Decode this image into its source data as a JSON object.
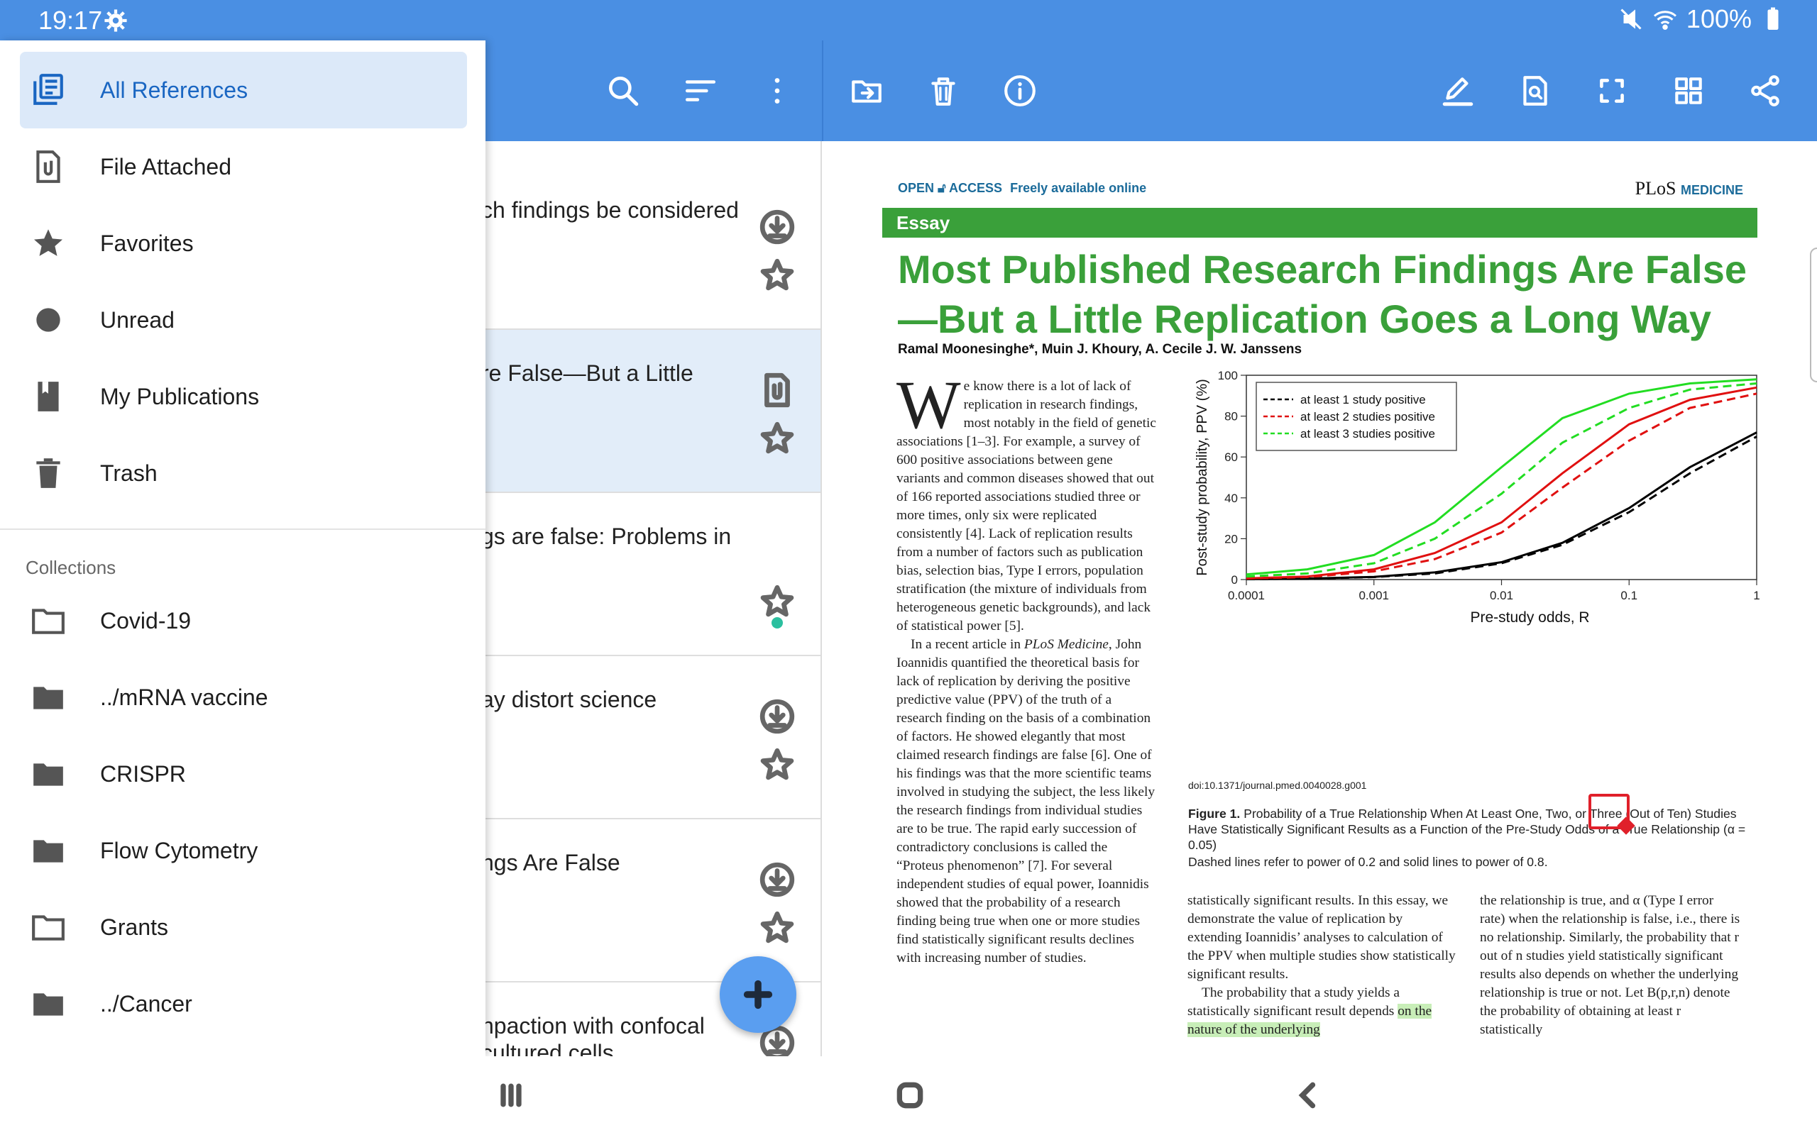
{
  "status": {
    "time": "19:17",
    "battery": "100%"
  },
  "list": {
    "rows": [
      {
        "title": "ch findings be considered",
        "has_pdf": false,
        "unread": false,
        "selected": false
      },
      {
        "title": "re False—But a Little",
        "has_pdf": true,
        "unread": false,
        "selected": true
      },
      {
        "title": "gs are false: Problems in",
        "has_pdf": null,
        "unread": true,
        "selected": false
      },
      {
        "title": "ay distort science",
        "has_pdf": false,
        "unread": false,
        "selected": false
      },
      {
        "title": "ngs Are False",
        "has_pdf": false,
        "unread": false,
        "selected": false
      },
      {
        "title": "npaction with confocal",
        "title2": "cultured cells",
        "has_pdf": false,
        "unread": false,
        "selected": false
      }
    ]
  },
  "drawer": {
    "items": [
      {
        "label": "All References",
        "icon": "library-icon",
        "selected": true
      },
      {
        "label": "File Attached",
        "icon": "attachment-file-icon"
      },
      {
        "label": "Favorites",
        "icon": "star-icon"
      },
      {
        "label": "Unread",
        "icon": "unread-dot-icon"
      },
      {
        "label": "My Publications",
        "icon": "bookmark-book-icon"
      },
      {
        "label": "Trash",
        "icon": "trash-icon"
      }
    ],
    "collections_header": "Collections",
    "collections": [
      {
        "label": "Covid-19",
        "icon": "folder-outline-icon"
      },
      {
        "label": "../mRNA vaccine",
        "icon": "folder-icon"
      },
      {
        "label": "CRISPR",
        "icon": "folder-icon"
      },
      {
        "label": "Flow Cytometry",
        "icon": "folder-icon"
      },
      {
        "label": "Grants",
        "icon": "folder-outline-icon"
      },
      {
        "label": "../Cancer",
        "icon": "folder-icon"
      }
    ]
  },
  "pdf": {
    "header_left_open": "OPEN",
    "header_left_access": "ACCESS",
    "header_left_free": "Freely available online",
    "journal_plos": "PLoS",
    "journal_medicine": "MEDICINE",
    "section": "Essay",
    "title": "Most Published Research Findings Are False—But a Little Replication Goes a Long Way",
    "authors": "Ramal Moonesinghe*, Muin J. Khoury, A. Cecile J. W. Janssens",
    "col1_dropcap": "W",
    "col1_p1": "e know there is a lot of lack of replication in research findings, most notably in the field of genetic associations [1–3]. For example, a survey of 600 positive associations between gene variants and common diseases showed that out of 166 reported associations studied three or more times, only six were replicated consistently [4]. Lack of replication results from a number of factors such as publication bias, selection bias, Type I errors, population stratification (the mixture of individuals from heterogeneous genetic backgrounds), and lack of statistical power [5].",
    "col1_p2a": "In a recent article in ",
    "col1_p2_em": "PLoS Medicine",
    "col1_p2b": ", John Ioannidis quantified the theoretical basis for lack of replication by deriving the positive predictive value (PPV) of the truth of a research finding on the basis of a combination of factors. He showed elegantly that most claimed research findings are false [6]. One of his findings was that the more scientific teams involved in studying the subject, the less likely the research findings from individual studies are to be true. The rapid early succession of contradictory conclusions is called the “Proteus phenomenon” [7]. For several independent studies of equal power, Ioannidis showed that the probability of a research finding being true when one or more studies find statistically significant results declines with increasing number of studies.",
    "col2_p1": "statistically significant results. In this essay, we demonstrate the value of replication by extending Ioannidis’ analyses to calculation of the PPV when multiple studies show statistically significant results.",
    "col2_p2": "The probability that a study yields a statistically significant result depends ",
    "col2_hl": "on the nature of the underlying",
    "col3_p1": "the relationship is true, and α (Type I error rate) when the relationship is false, i.e., there is no relationship. Similarly, the probability that r out of n studies yield statistically significant results also depends on whether the underlying relationship is true or not. Let B(p,r,n) denote the probability of obtaining at least r statistically",
    "doi": "doi:10.1371/journal.pmed.0040028.g001",
    "fig_label": "Figure 1.",
    "fig_caption": " Probability of a True Relationship When At Least One, Two, or Three (Out of Ten) Studies Have Statistically Significant Results as a Function of the Pre-Study Odds of a True Relationship (α = 0.05)",
    "fig_caption2": "Dashed lines refer to power of 0.2 and solid lines to power of 0.8."
  },
  "chart_data": {
    "type": "line",
    "xscale": "log",
    "xlim": [
      0.0001,
      1
    ],
    "ylim": [
      0,
      100
    ],
    "xlabel": "Pre-study odds, R",
    "ylabel": "Post-study probability, PPV (%)",
    "xticks": [
      "0.0001",
      "0.001",
      "0.01",
      "0.1",
      "1"
    ],
    "yticks": [
      "0",
      "20",
      "40",
      "60",
      "80",
      "100"
    ],
    "legend_position": "top-left",
    "legend": [
      {
        "label": "at least 1 study positive",
        "color": "#000000"
      },
      {
        "label": "at least 2 studies positive",
        "color": "#e01010"
      },
      {
        "label": "at least 3 studies positive",
        "color": "#22dd22"
      }
    ],
    "x": [
      0.0001,
      0.0003,
      0.001,
      0.003,
      0.01,
      0.03,
      0.1,
      0.3,
      1
    ],
    "series": [
      {
        "color": "#000000",
        "dash": false,
        "values": [
          0.2,
          0.5,
          1.3,
          3.5,
          8.5,
          18,
          35,
          55,
          72
        ]
      },
      {
        "color": "#000000",
        "dash": true,
        "values": [
          0.2,
          0.4,
          1.2,
          3.0,
          8.0,
          17,
          33,
          52,
          70
        ]
      },
      {
        "color": "#e01010",
        "dash": false,
        "values": [
          0.6,
          1.5,
          5,
          13,
          28,
          52,
          76,
          88,
          94
        ]
      },
      {
        "color": "#e01010",
        "dash": true,
        "values": [
          0.5,
          1.2,
          4,
          10,
          23,
          45,
          68,
          84,
          91
        ]
      },
      {
        "color": "#22dd22",
        "dash": false,
        "values": [
          2.5,
          5,
          12,
          28,
          55,
          79,
          91,
          96,
          98
        ]
      },
      {
        "color": "#22dd22",
        "dash": true,
        "values": [
          1.5,
          3,
          8,
          20,
          42,
          67,
          84,
          93,
          96
        ]
      }
    ]
  }
}
